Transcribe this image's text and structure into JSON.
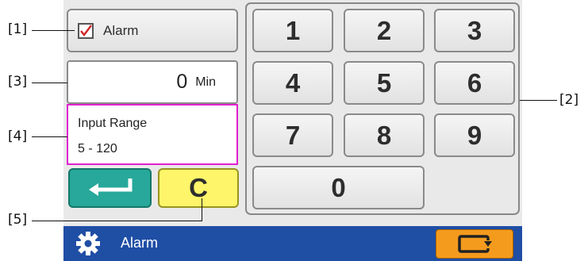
{
  "callouts": {
    "c1": "[1]",
    "c2": "[2]",
    "c3": "[3]",
    "c4": "[4]",
    "c5": "[5]"
  },
  "alarm_toggle": {
    "label": "Alarm",
    "checked": true
  },
  "time_field": {
    "value": "0",
    "unit": "Min"
  },
  "input_range": {
    "title": "Input Range",
    "value": "5 - 120"
  },
  "keypad": {
    "keys": [
      "1",
      "2",
      "3",
      "4",
      "5",
      "6",
      "7",
      "8",
      "9",
      "0"
    ]
  },
  "clear_label": "C",
  "bottom_bar": {
    "title": "Alarm",
    "icon": "gear-icon"
  },
  "colors": {
    "range_border": "#e020d0",
    "enter": "#27a89a",
    "clear": "#fff56a",
    "bar": "#1f4ea5",
    "orange": "#f49b1e"
  }
}
